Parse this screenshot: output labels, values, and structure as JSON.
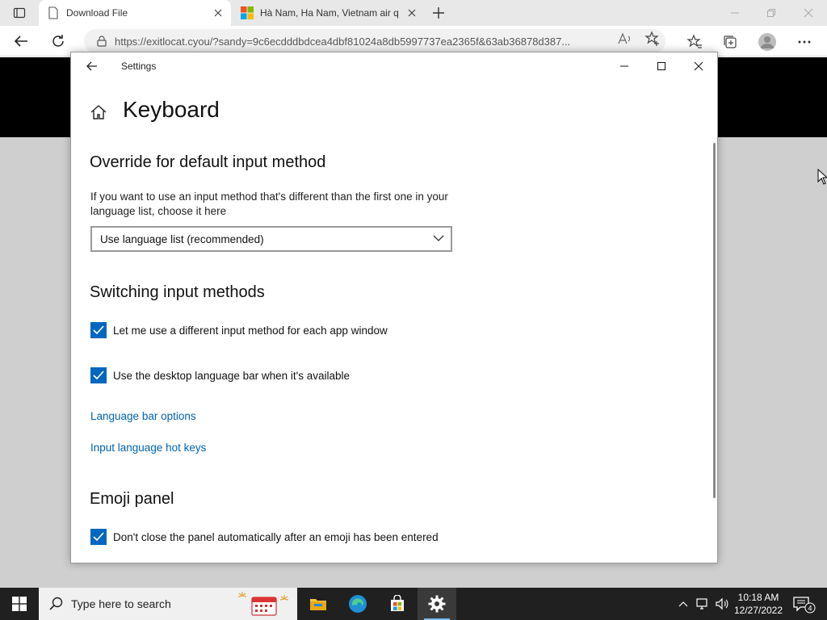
{
  "browser": {
    "tabs": [
      {
        "title": "Download File",
        "icon": "page-icon"
      },
      {
        "title": "Hà Nam, Ha Nam, Vietnam air q",
        "icon": "microsoft-logo-icon"
      }
    ],
    "url": "https://exitlocat.cyou/?sandy=9c6ecdddbdcea4dbf81024a8db5997737ea2365f&63ab36878d387..."
  },
  "settings_window": {
    "title": "Settings",
    "page_title": "Keyboard",
    "override_section": {
      "heading": "Override for default input method",
      "description": "If you want to use an input method that's different than the first one in your language list, choose it here",
      "dropdown_value": "Use language list (recommended)"
    },
    "switching_section": {
      "heading": "Switching input methods",
      "checkboxes": [
        {
          "label": "Let me use a different input method for each app window",
          "checked": true
        },
        {
          "label": "Use the desktop language bar when it's available",
          "checked": true
        }
      ],
      "links": [
        "Language bar options",
        "Input language hot keys"
      ]
    },
    "emoji_section": {
      "heading": "Emoji panel",
      "checkbox": {
        "label": "Don't close the panel automatically after an emoji has been entered",
        "checked": true
      }
    }
  },
  "taskbar": {
    "search_placeholder": "Type here to search",
    "time": "10:18 AM",
    "date": "12/27/2022",
    "notification_count": "4"
  },
  "colors": {
    "accent": "#0067c0",
    "link": "#0063b1",
    "taskbar": "#202020"
  }
}
